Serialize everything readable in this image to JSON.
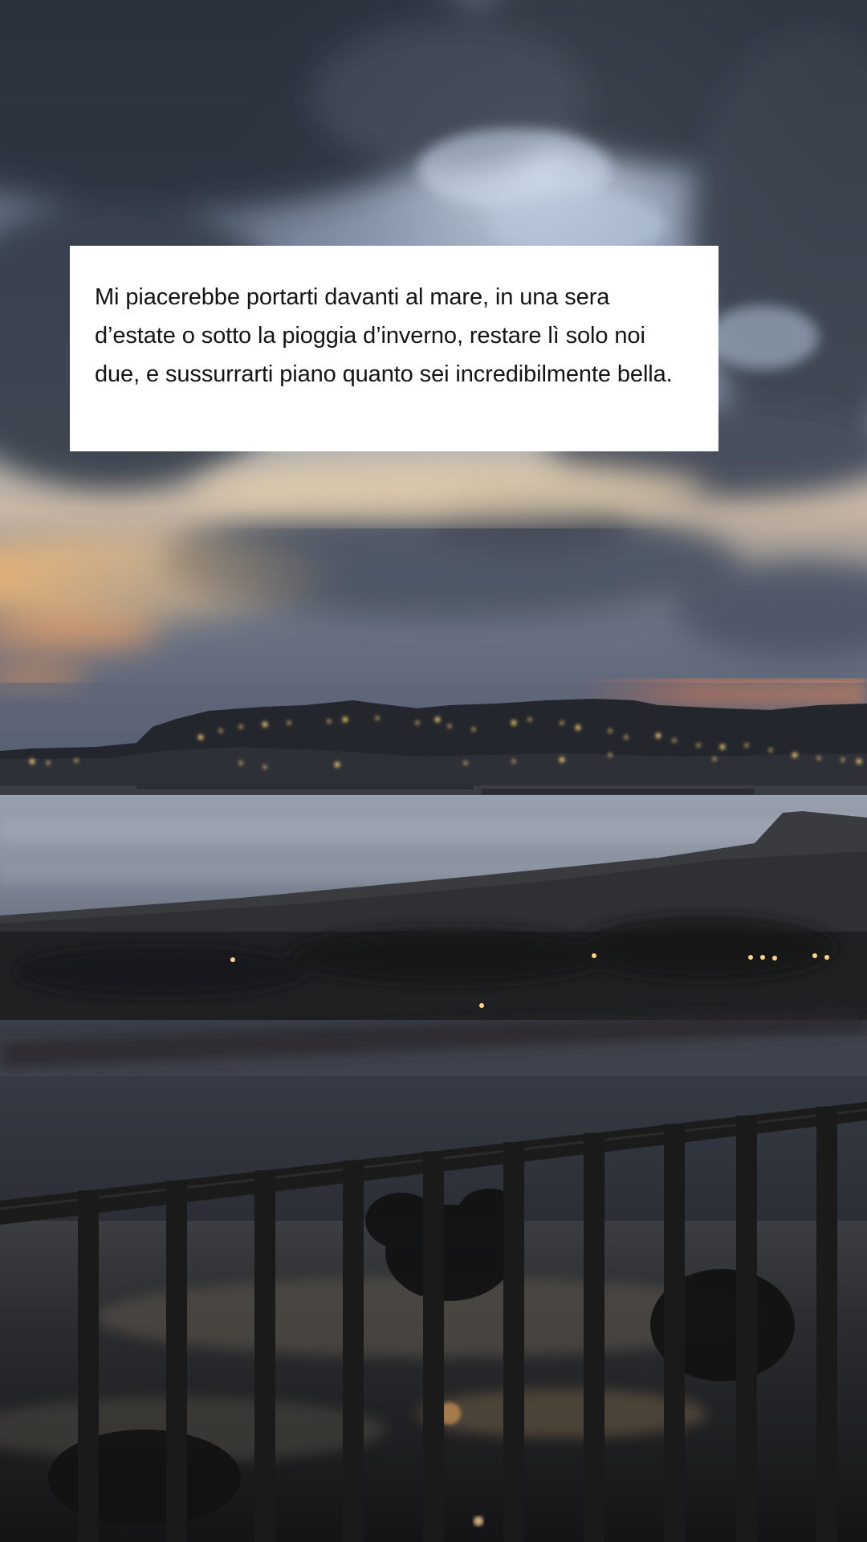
{
  "caption": {
    "text": "Mi piacerebbe portarti davanti al mare, in una sera d’estate o sotto la pioggia d’inverno, restare lì solo noi due, e sussurrarti piano quanto sei incredibilmente bella."
  },
  "photo": {
    "subject": "seaside-at-dusk",
    "colors": {
      "sky_dark": "#3a4250",
      "sky_light": "#c9d6e6",
      "sunset_orange": "#f2a35a",
      "sunset_red": "#e0674a",
      "sea": "#8f96a4",
      "railing": "#1c1b1c"
    }
  }
}
